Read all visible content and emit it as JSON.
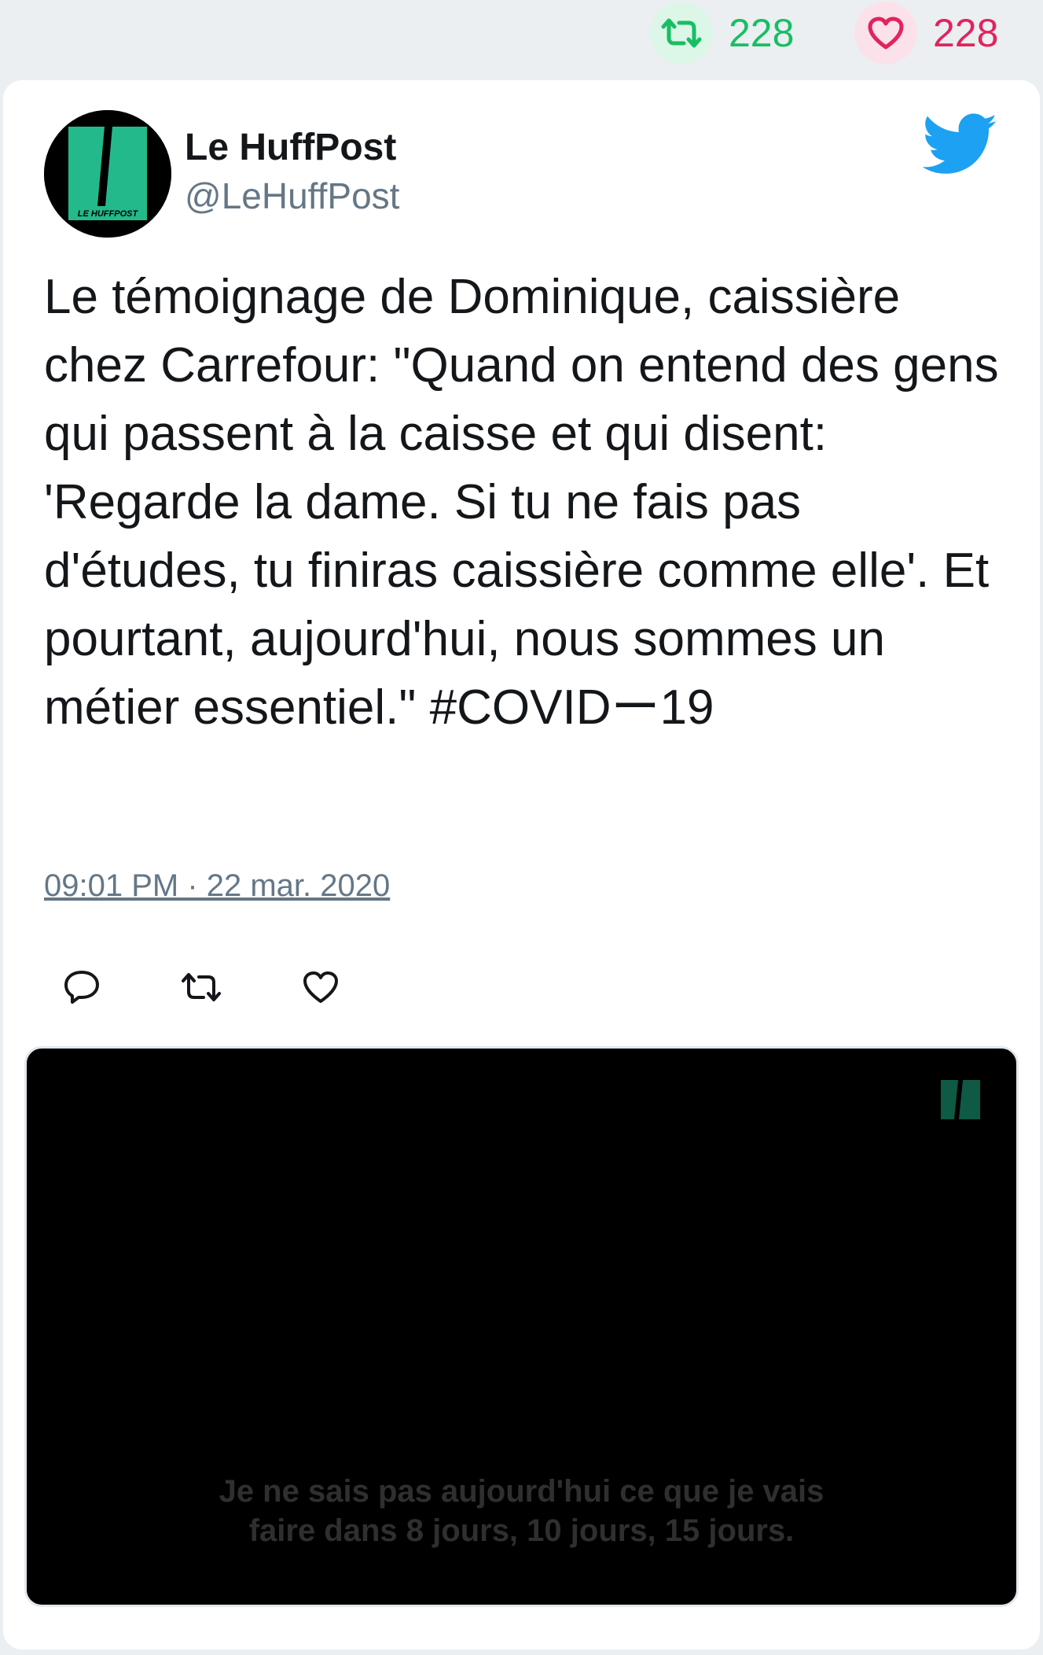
{
  "stats": {
    "retweets": "228",
    "likes": "228"
  },
  "author": {
    "display_name": "Le HuffPost",
    "handle": "@LeHuffPost",
    "avatar_text": "LE HUFFPOST"
  },
  "tweet": {
    "text": "Le témoignage de Dominique, caissière chez Carrefour: \"Quand on entend des gens qui passent à la caisse et qui disent: 'Regarde la dame. Si tu ne fais pas d'études, tu finiras caissière comme elle'. Et pourtant, aujourd'hui, nous sommes un métier essentiel.\" #COVIDー19",
    "timestamp": "09:01 PM · 22 mar. 2020"
  },
  "video": {
    "caption_line1": "Je ne sais pas aujourd'hui ce que je vais",
    "caption_line2": "faire dans 8 jours, 10 jours, 15 jours."
  },
  "icons": {
    "retweet": "retweet-icon",
    "like": "heart-icon",
    "reply": "reply-icon",
    "twitter": "twitter-bird-icon"
  },
  "colors": {
    "retweet": "#17bf63",
    "like": "#e0245e",
    "twitter_blue": "#1da1f2",
    "huffpost_green": "#23b98b"
  }
}
